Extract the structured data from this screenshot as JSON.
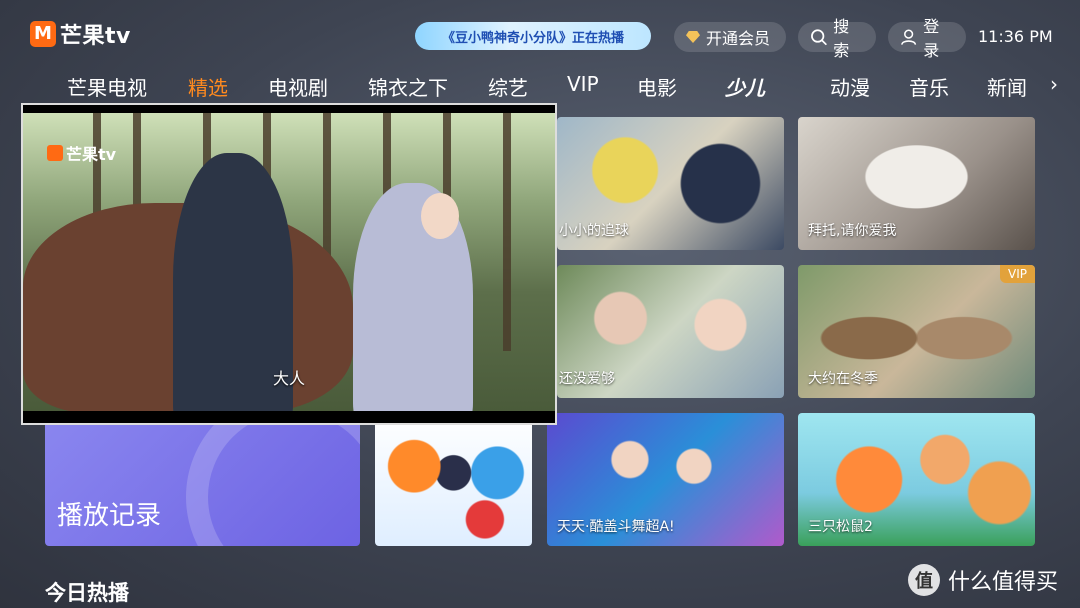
{
  "header": {
    "logo_text": "芒果tv",
    "banner_text": "《豆小鸭神奇小分队》正在热播",
    "vip_label": "开通会员",
    "search_label": "搜索",
    "login_label": "登录",
    "time": "11:36 PM"
  },
  "nav": {
    "items": [
      "芒果电视",
      "精选",
      "电视剧",
      "锦衣之下",
      "综艺",
      "VIP",
      "电影",
      "少儿",
      "动漫",
      "音乐",
      "新闻"
    ],
    "active_index": 1
  },
  "player": {
    "logo_text": "芒果tv",
    "subtitle": "大人"
  },
  "tiles": [
    {
      "label": "小小的追球",
      "vip": false
    },
    {
      "label": "拜托,请你爱我",
      "vip": false
    },
    {
      "label": "还没爱够",
      "vip": false
    },
    {
      "label": "大约在冬季",
      "vip": true,
      "badge": "VIP"
    },
    {
      "label": "",
      "vip": false
    },
    {
      "label": "天天·酷盖斗舞超A!",
      "vip": false
    },
    {
      "label": "三只松鼠2",
      "vip": false
    }
  ],
  "history": {
    "label": "播放记录"
  },
  "section": {
    "title": "今日热播"
  },
  "watermark": {
    "icon_char": "值",
    "text": "什么值得买"
  },
  "colors": {
    "accent": "#ff8a1f",
    "brand": "#ff6a13",
    "vip_badge": "#e2a23b"
  }
}
